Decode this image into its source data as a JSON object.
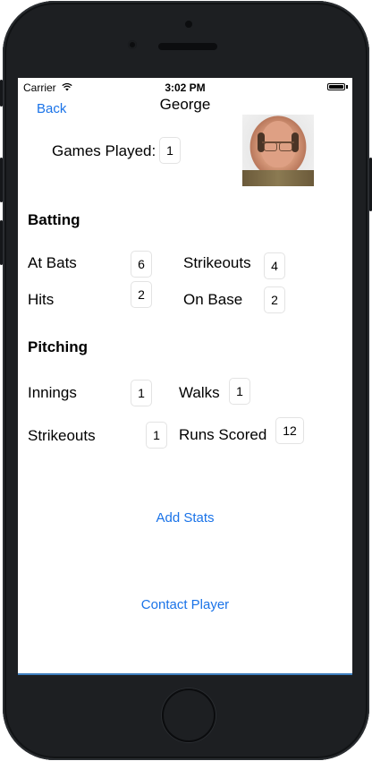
{
  "status_bar": {
    "carrier": "Carrier",
    "time": "3:02 PM"
  },
  "nav": {
    "back_label": "Back",
    "title": "George"
  },
  "games_played": {
    "label": "Games Played:",
    "value": "1"
  },
  "batting": {
    "heading": "Batting",
    "at_bats": {
      "label": "At Bats",
      "value": "6"
    },
    "hits": {
      "label": "Hits",
      "value": "2"
    },
    "strikeouts": {
      "label": "Strikeouts",
      "value": "4"
    },
    "on_base": {
      "label": "On Base",
      "value": "2"
    }
  },
  "pitching": {
    "heading": "Pitching",
    "innings": {
      "label": "Innings",
      "value": "1"
    },
    "walks": {
      "label": "Walks",
      "value": "1"
    },
    "strikeouts": {
      "label": "Strikeouts",
      "value": "1"
    },
    "runs_scored": {
      "label": "Runs Scored",
      "value": "12"
    }
  },
  "actions": {
    "add_stats": "Add Stats",
    "contact_player": "Contact Player"
  },
  "colors": {
    "accent": "#1a73e8",
    "device": "#1d1f22"
  }
}
